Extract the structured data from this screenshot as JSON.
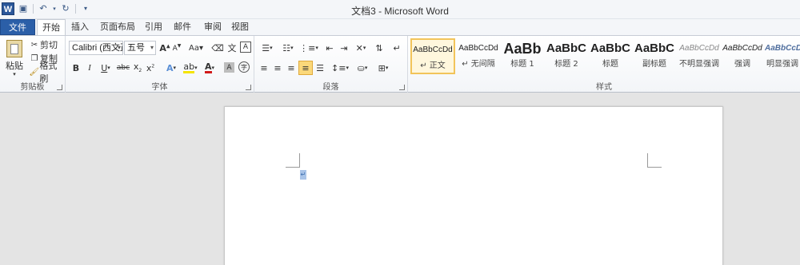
{
  "window": {
    "title": "文档3 - Microsoft Word"
  },
  "qat": {
    "logo": "W"
  },
  "tabs": [
    {
      "label": "文件"
    },
    {
      "label": "开始"
    },
    {
      "label": "插入"
    },
    {
      "label": "页面布局"
    },
    {
      "label": "引用"
    },
    {
      "label": "邮件"
    },
    {
      "label": "审阅"
    },
    {
      "label": "视图"
    }
  ],
  "clipboard": {
    "paste_label": "粘贴",
    "cut_label": "剪切",
    "copy_label": "复制",
    "format_painter_label": "格式刷",
    "group_label": "剪贴板"
  },
  "font": {
    "font_name": "Calibri (西文正",
    "font_size": "五号",
    "group_label": "字体"
  },
  "paragraph": {
    "group_label": "段落"
  },
  "styles": {
    "group_label": "样式",
    "items": [
      {
        "preview": "AaBbCcDd",
        "name": "↵ 正文"
      },
      {
        "preview": "AaBbCcDd",
        "name": "↵ 无间隔"
      },
      {
        "preview": "AaBb",
        "name": "标题 1"
      },
      {
        "preview": "AaBbC",
        "name": "标题 2"
      },
      {
        "preview": "AaBbC",
        "name": "标题"
      },
      {
        "preview": "AaBbC",
        "name": "副标题"
      },
      {
        "preview": "AaBbCcDd",
        "name": "不明显强调"
      },
      {
        "preview": "AaBbCcDd",
        "name": "强调"
      },
      {
        "preview": "AaBbCcDd",
        "name": "明显强调"
      }
    ]
  },
  "document": {
    "paragraph_mark": "↵"
  },
  "colors": {
    "file_tab": "#2b5fa8",
    "accent": "#2b579a",
    "selected_style_border": "#f2c45a",
    "text_color_bar": "#d11a1a",
    "highlight_bar": "#f5e400"
  }
}
